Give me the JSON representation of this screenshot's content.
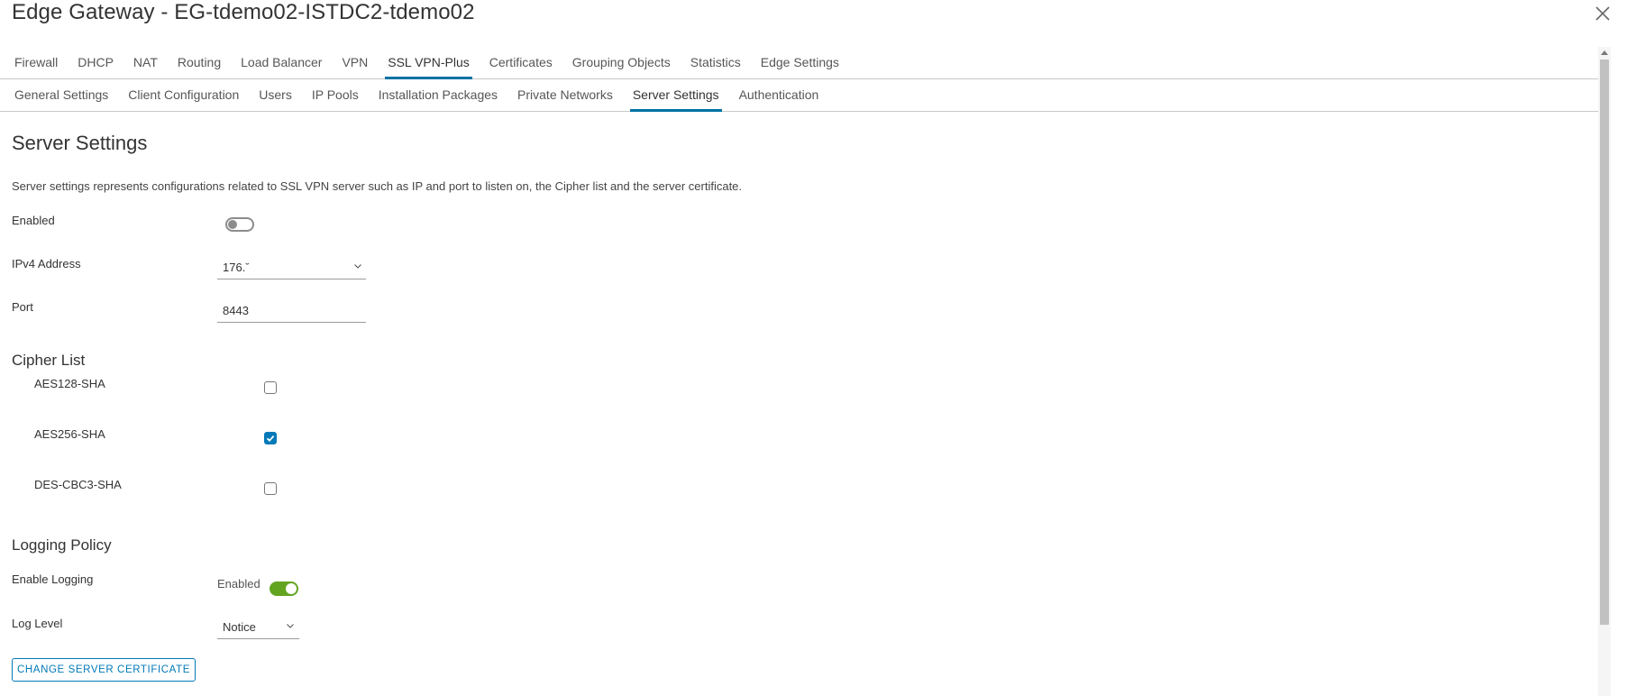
{
  "window": {
    "title": "Edge Gateway - EG-tdemo02-ISTDC2-tdemo02"
  },
  "main_tabs": [
    {
      "label": "Firewall"
    },
    {
      "label": "DHCP"
    },
    {
      "label": "NAT"
    },
    {
      "label": "Routing"
    },
    {
      "label": "Load Balancer"
    },
    {
      "label": "VPN"
    },
    {
      "label": "SSL VPN-Plus",
      "active": true
    },
    {
      "label": "Certificates"
    },
    {
      "label": "Grouping Objects"
    },
    {
      "label": "Statistics"
    },
    {
      "label": "Edge Settings"
    }
  ],
  "sub_tabs": [
    {
      "label": "General Settings"
    },
    {
      "label": "Client Configuration"
    },
    {
      "label": "Users"
    },
    {
      "label": "IP Pools"
    },
    {
      "label": "Installation Packages"
    },
    {
      "label": "Private Networks"
    },
    {
      "label": "Server Settings",
      "active": true
    },
    {
      "label": "Authentication"
    }
  ],
  "server_settings": {
    "heading": "Server Settings",
    "description": "Server settings represents configurations related to SSL VPN server such as IP and port to listen on, the Cipher list and the server certificate.",
    "enabled": {
      "label": "Enabled",
      "on": false
    },
    "ipv4": {
      "label": "IPv4 Address",
      "value": "176.ˇ"
    },
    "port": {
      "label": "Port",
      "value": "8443"
    }
  },
  "cipher_list": {
    "heading": "Cipher List",
    "items": [
      {
        "label": "AES128-SHA",
        "checked": false
      },
      {
        "label": "AES256-SHA",
        "checked": true
      },
      {
        "label": "DES-CBC3-SHA",
        "checked": false
      }
    ]
  },
  "logging_policy": {
    "heading": "Logging Policy",
    "enable_logging": {
      "label": "Enable Logging",
      "state_text": "Enabled",
      "on": true
    },
    "log_level": {
      "label": "Log Level",
      "value": "Notice"
    }
  },
  "actions": {
    "change_cert_label": "CHANGE SERVER CERTIFICATE"
  },
  "colors": {
    "accent": "#0079b8",
    "toggle_on": "#62a420"
  },
  "icons": {
    "close": "close-icon",
    "dropdown": "chevron-down-icon",
    "check": "check-icon"
  }
}
